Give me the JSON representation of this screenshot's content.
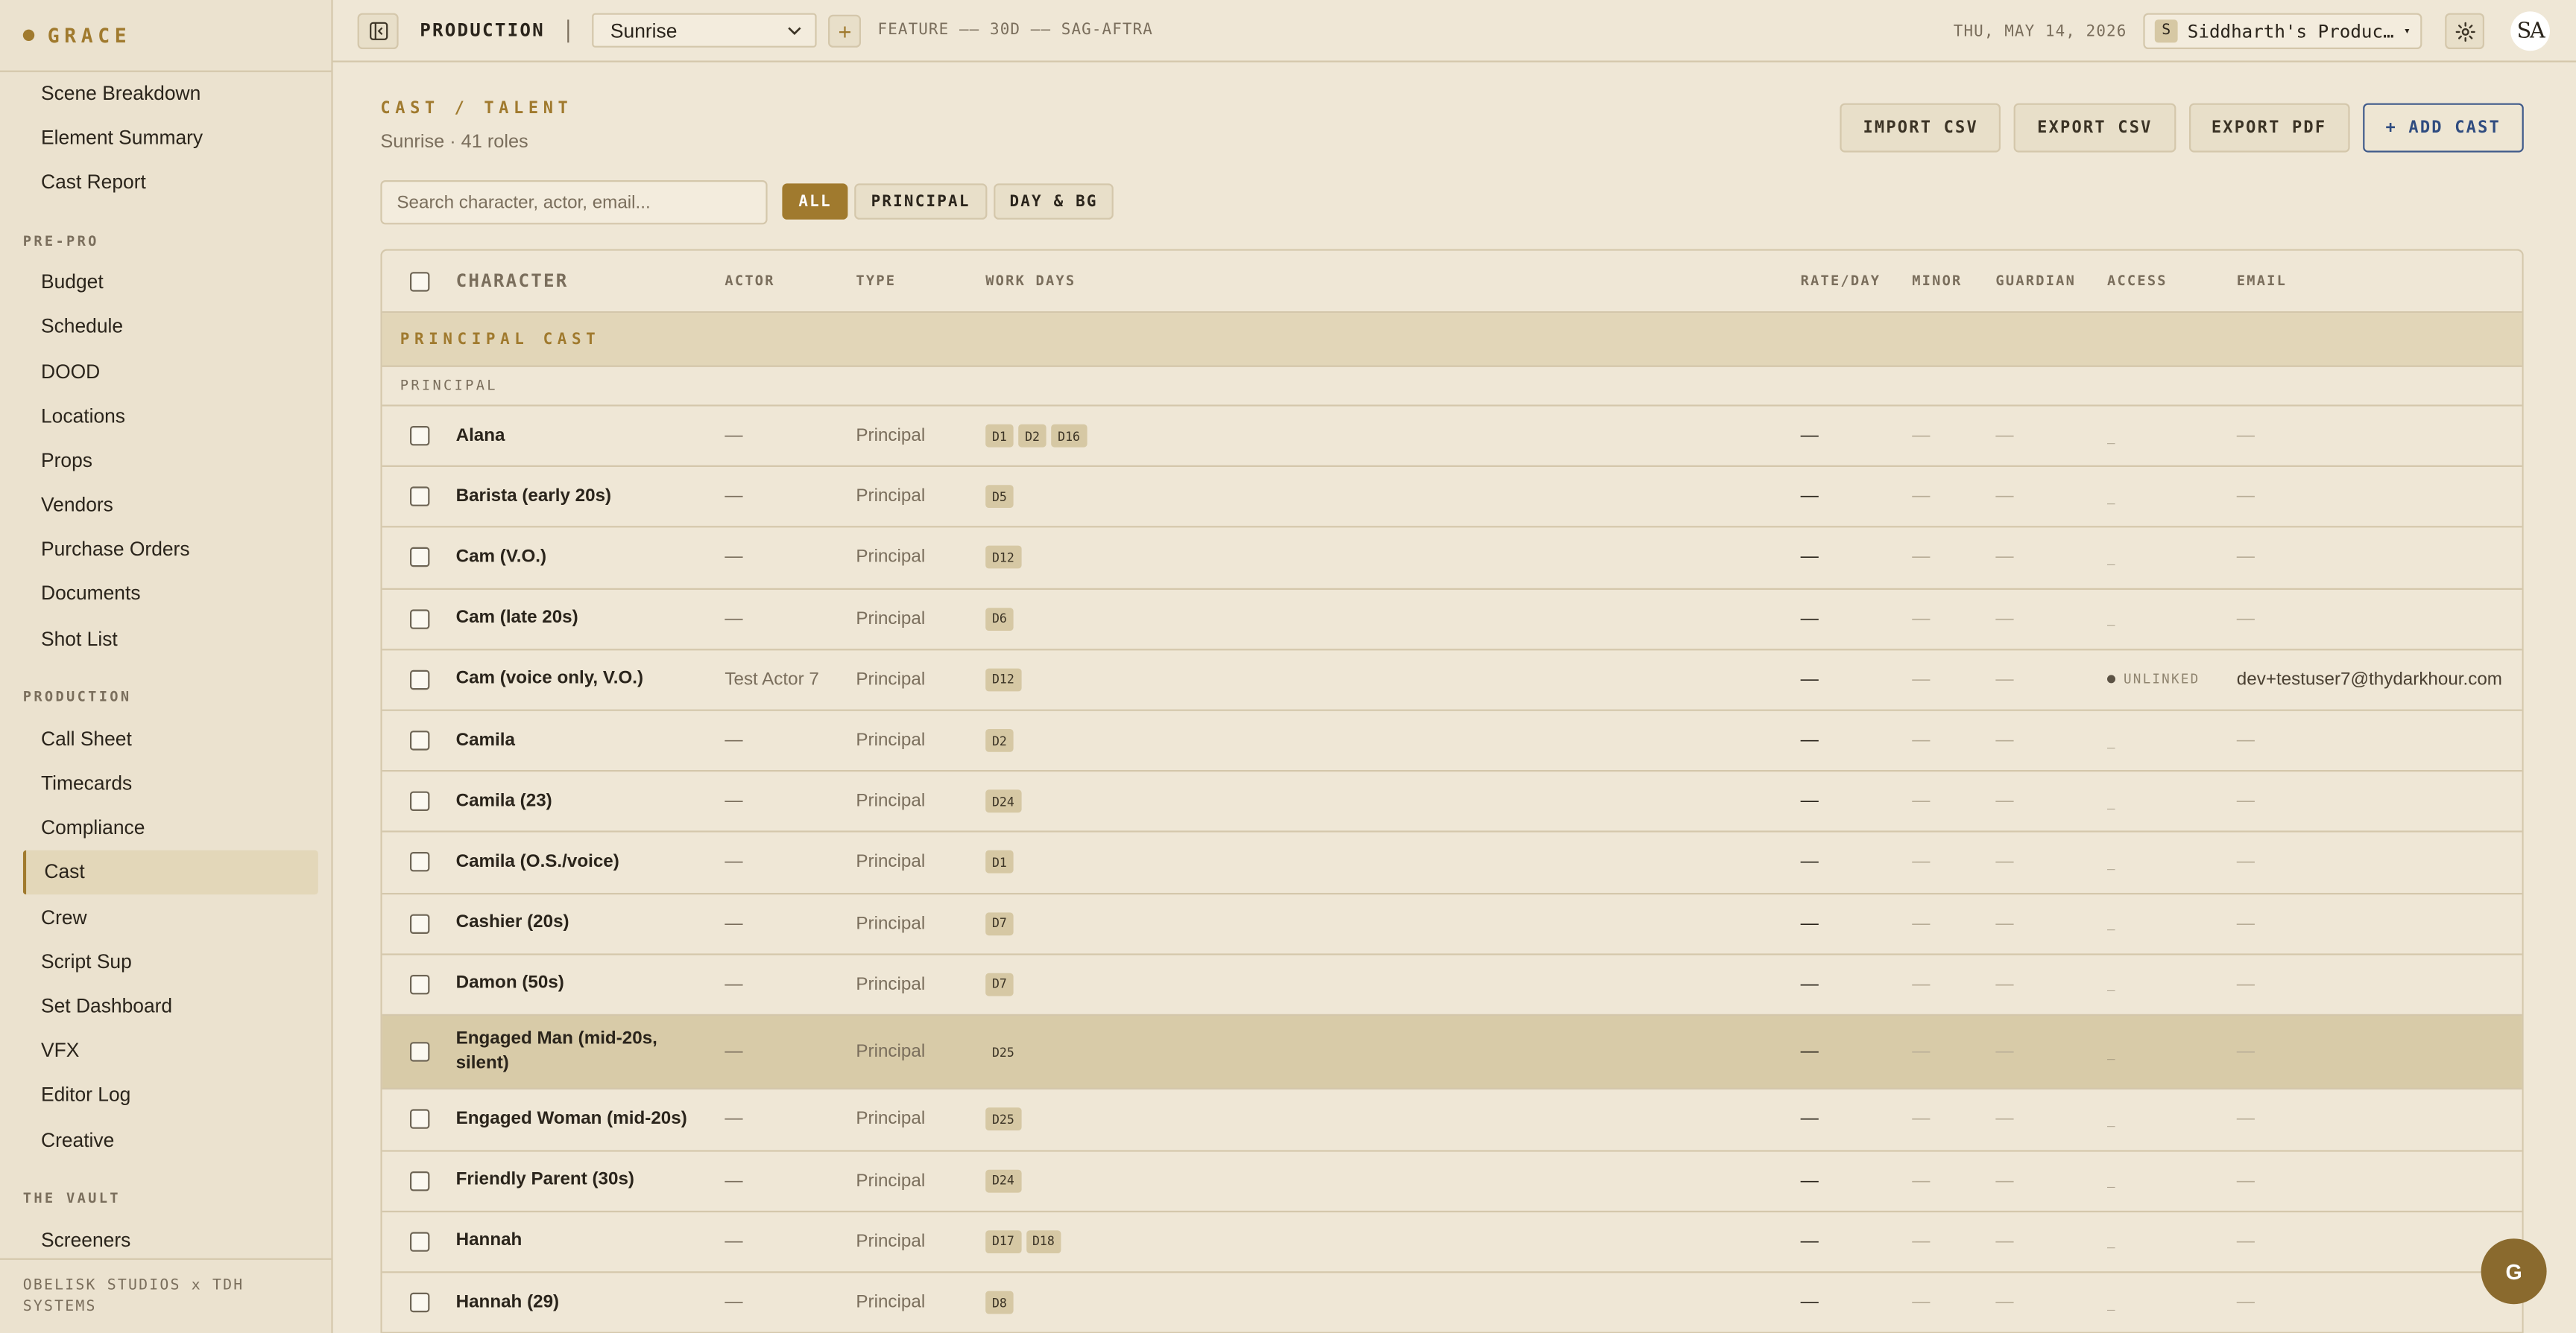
{
  "brand": {
    "name": "GRACE"
  },
  "sidebar": {
    "top_items": [
      "Scene Breakdown",
      "Element Summary",
      "Cast Report"
    ],
    "sections": [
      {
        "title": "PRE-PRO",
        "items": [
          "Budget",
          "Schedule",
          "DOOD",
          "Locations",
          "Props",
          "Vendors",
          "Purchase Orders",
          "Documents",
          "Shot List"
        ]
      },
      {
        "title": "PRODUCTION",
        "items": [
          "Call Sheet",
          "Timecards",
          "Compliance",
          "Cast",
          "Crew",
          "Script Sup",
          "Set Dashboard",
          "VFX",
          "Editor Log",
          "Creative"
        ]
      },
      {
        "title": "THE VAULT",
        "items": [
          "Screeners"
        ]
      }
    ],
    "active": "Cast",
    "footer": "OBELISK STUDIOS x TDH SYSTEMS"
  },
  "topbar": {
    "module": "PRODUCTION",
    "project": "Sunrise",
    "meta": "FEATURE —— 30D —— SAG-AFTRA",
    "date": "THU, MAY 14, 2026",
    "org_initial": "S",
    "org_name": "Siddharth's Producti…",
    "user_initials": "SA"
  },
  "page": {
    "title": "CAST / TALENT",
    "subtitle": "Sunrise · 41 roles",
    "actions": [
      "IMPORT CSV",
      "EXPORT CSV",
      "EXPORT PDF",
      "+ ADD CAST"
    ],
    "search_placeholder": "Search character, actor, email...",
    "filters": [
      "ALL",
      "PRINCIPAL",
      "DAY & BG"
    ],
    "active_filter": "ALL"
  },
  "table": {
    "headers": {
      "character": "CHARACTER",
      "actor": "ACTOR",
      "type": "TYPE",
      "days": "WORK DAYS",
      "rate": "RATE/DAY",
      "minor": "MINOR",
      "guardian": "GUARDIAN",
      "access": "ACCESS",
      "email": "EMAIL"
    },
    "group": "PRINCIPAL CAST",
    "subgroup": "PRINCIPAL",
    "rows": [
      {
        "character": "Alana",
        "actor": "—",
        "type": "Principal",
        "days": [
          "D1",
          "D2",
          "D16"
        ],
        "rate": "—",
        "minor": "—",
        "guardian": "—",
        "access": "_",
        "email": "—"
      },
      {
        "character": "Barista (early 20s)",
        "actor": "—",
        "type": "Principal",
        "days": [
          "D5"
        ],
        "rate": "—",
        "minor": "—",
        "guardian": "—",
        "access": "_",
        "email": "—"
      },
      {
        "character": "Cam (V.O.)",
        "actor": "—",
        "type": "Principal",
        "days": [
          "D12"
        ],
        "rate": "—",
        "minor": "—",
        "guardian": "—",
        "access": "_",
        "email": "—"
      },
      {
        "character": "Cam (late 20s)",
        "actor": "—",
        "type": "Principal",
        "days": [
          "D6"
        ],
        "rate": "—",
        "minor": "—",
        "guardian": "—",
        "access": "_",
        "email": "—"
      },
      {
        "character": "Cam (voice only, V.O.)",
        "actor": "Test Actor 7",
        "type": "Principal",
        "days": [
          "D12"
        ],
        "rate": "—",
        "minor": "—",
        "guardian": "—",
        "access": "UNLINKED",
        "email": "dev+testuser7@thydarkhour.com"
      },
      {
        "character": "Camila",
        "actor": "—",
        "type": "Principal",
        "days": [
          "D2"
        ],
        "rate": "—",
        "minor": "—",
        "guardian": "—",
        "access": "_",
        "email": "—"
      },
      {
        "character": "Camila (23)",
        "actor": "—",
        "type": "Principal",
        "days": [
          "D24"
        ],
        "rate": "—",
        "minor": "—",
        "guardian": "—",
        "access": "_",
        "email": "—"
      },
      {
        "character": "Camila (O.S./voice)",
        "actor": "—",
        "type": "Principal",
        "days": [
          "D1"
        ],
        "rate": "—",
        "minor": "—",
        "guardian": "—",
        "access": "_",
        "email": "—"
      },
      {
        "character": "Cashier (20s)",
        "actor": "—",
        "type": "Principal",
        "days": [
          "D7"
        ],
        "rate": "—",
        "minor": "—",
        "guardian": "—",
        "access": "_",
        "email": "—"
      },
      {
        "character": "Damon (50s)",
        "actor": "—",
        "type": "Principal",
        "days": [
          "D7"
        ],
        "rate": "—",
        "minor": "—",
        "guardian": "—",
        "access": "_",
        "email": "—"
      },
      {
        "character": "Engaged Man (mid-20s, silent)",
        "actor": "—",
        "type": "Principal",
        "days": [
          "D25"
        ],
        "rate": "—",
        "minor": "—",
        "guardian": "—",
        "access": "_",
        "email": "—"
      },
      {
        "character": "Engaged Woman (mid-20s)",
        "actor": "—",
        "type": "Principal",
        "days": [
          "D25"
        ],
        "rate": "—",
        "minor": "—",
        "guardian": "—",
        "access": "_",
        "email": "—"
      },
      {
        "character": "Friendly Parent (30s)",
        "actor": "—",
        "type": "Principal",
        "days": [
          "D24"
        ],
        "rate": "—",
        "minor": "—",
        "guardian": "—",
        "access": "_",
        "email": "—"
      },
      {
        "character": "Hannah",
        "actor": "—",
        "type": "Principal",
        "days": [
          "D17",
          "D18"
        ],
        "rate": "—",
        "minor": "—",
        "guardian": "—",
        "access": "_",
        "email": "—"
      },
      {
        "character": "Hannah (29)",
        "actor": "—",
        "type": "Principal",
        "days": [
          "D8"
        ],
        "rate": "—",
        "minor": "—",
        "guardian": "—",
        "access": "_",
        "email": "—"
      }
    ]
  },
  "fab": {
    "label": "G"
  },
  "colors": {
    "accent": "#a07a2e",
    "primary_button": "#2f4c80",
    "background": "#efe7d6"
  }
}
